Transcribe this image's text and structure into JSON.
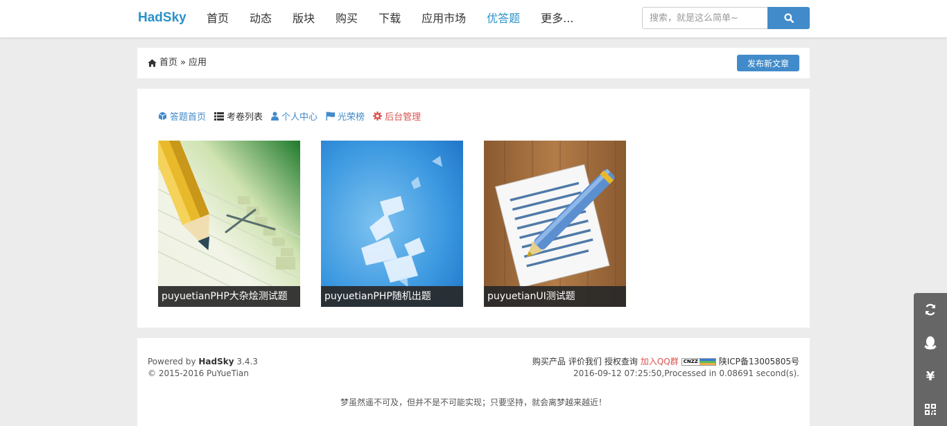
{
  "header": {
    "brand": "HadSky",
    "nav": [
      {
        "label": "首页",
        "active": false
      },
      {
        "label": "动态",
        "active": false
      },
      {
        "label": "版块",
        "active": false
      },
      {
        "label": "购买",
        "active": false
      },
      {
        "label": "下载",
        "active": false
      },
      {
        "label": "应用市场",
        "active": false
      },
      {
        "label": "优答题",
        "active": true
      },
      {
        "label": "更多...",
        "active": false
      }
    ],
    "search": {
      "placeholder": "搜索，就是这么简单~",
      "value": ""
    }
  },
  "breadcrumb": {
    "home": "首页",
    "separator": "»",
    "current": "应用"
  },
  "publish_label": "发布新文章",
  "subnav": [
    {
      "icon": "cube-icon",
      "label": "答题首页"
    },
    {
      "icon": "list-icon",
      "label": "考卷列表"
    },
    {
      "icon": "user-icon",
      "label": "个人中心"
    },
    {
      "icon": "flag-icon",
      "label": "光荣榜"
    },
    {
      "icon": "cog-icon",
      "label": "后台管理"
    }
  ],
  "cards": [
    {
      "title": "puyuetianPHP大杂烩测试题"
    },
    {
      "title": "puyuetianPHP随机出题"
    },
    {
      "title": "puyuetianUI测试题"
    }
  ],
  "footer": {
    "powered_prefix": "Powered by",
    "powered_name": "HadSky",
    "version": "3.4.3",
    "copyright": "© 2015-2016 PuYueTian",
    "links": [
      "购买产品",
      "评价我们",
      "授权查询"
    ],
    "qq_group": "加入QQ群",
    "cnzz": "CNZZ",
    "icp": "陕ICP备13005805号",
    "processed": "2016-09-12 07:25:50,Processed in 0.08691 second(s).",
    "slogan": "梦虽然遥不可及，但并不是不可能实现；只要坚持，就会离梦越来越近！"
  },
  "tools": [
    "refresh-icon",
    "qq-icon",
    "yen-icon",
    "qrcode-icon"
  ],
  "colors": {
    "brand": "#2a91c9",
    "primary": "#428bca",
    "danger": "#d9534f",
    "background": "#ececec"
  }
}
